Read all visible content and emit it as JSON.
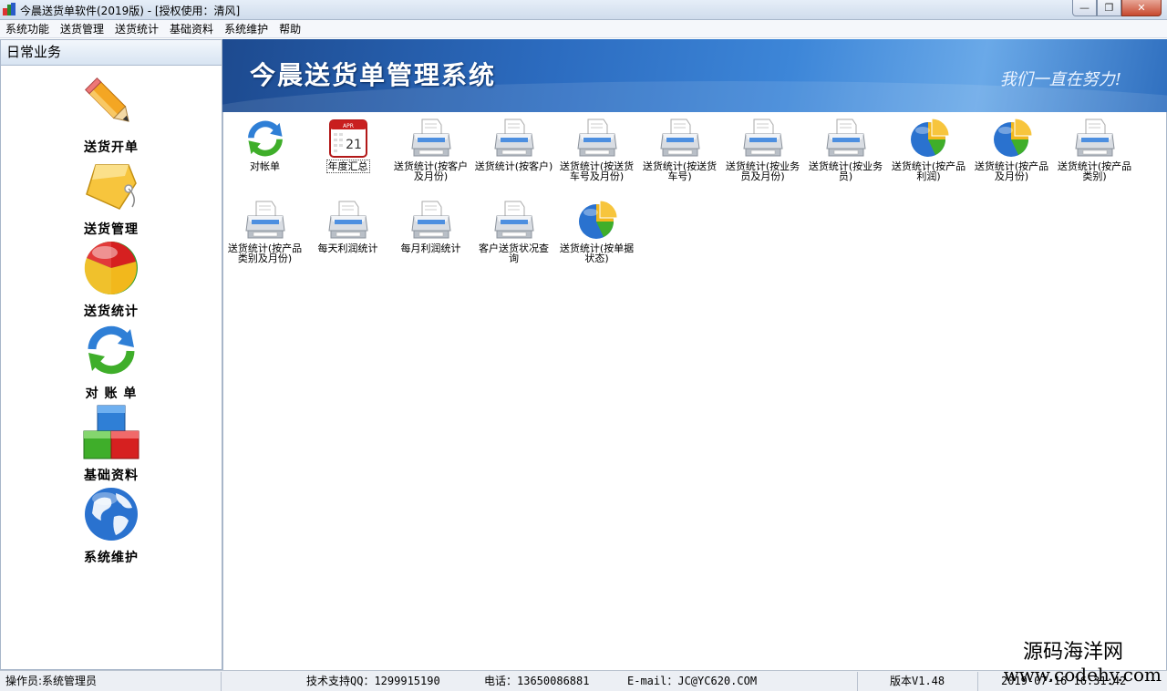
{
  "window": {
    "title": "今晨送货单软件(2019版) - [授权使用：清风]",
    "minimize_glyph": "—",
    "maximize_glyph": "❐",
    "close_glyph": "✕"
  },
  "menu": [
    "系统功能",
    "送货管理",
    "送货统计",
    "基础资料",
    "系统维护",
    "帮助"
  ],
  "left_panel": {
    "header": "日常业务",
    "items": [
      {
        "label": "送货开单",
        "icon": "pencil-icon"
      },
      {
        "label": "送货管理",
        "icon": "tag-icon"
      },
      {
        "label": "送货统计",
        "icon": "pie-ball-icon"
      },
      {
        "label": "对 账 单",
        "icon": "refresh-icon"
      },
      {
        "label": "基础资料",
        "icon": "blocks-icon"
      },
      {
        "label": "系统维护",
        "icon": "globe-icon"
      }
    ]
  },
  "banner": {
    "title": "今晨送货单管理系统",
    "slogan": "我们一直在努力!"
  },
  "tiles": [
    {
      "label": "对帐单",
      "icon": "refresh-icon"
    },
    {
      "label": "年度汇总",
      "icon": "calendar-icon",
      "calendar_month": "APR",
      "calendar_day": "21"
    },
    {
      "label": "送货统计(按客户及月份)",
      "icon": "printer-icon"
    },
    {
      "label": "送货统计(按客户)",
      "icon": "printer-icon"
    },
    {
      "label": "送货统计(按送货车号及月份)",
      "icon": "printer-icon"
    },
    {
      "label": "送货统计(按送货车号)",
      "icon": "printer-icon"
    },
    {
      "label": "送货统计(按业务员及月份)",
      "icon": "printer-icon"
    },
    {
      "label": "送货统计(按业务员)",
      "icon": "printer-icon"
    },
    {
      "label": "送货统计(按产品利润)",
      "icon": "pie-chart-icon"
    },
    {
      "label": "送货统计(按产品及月份)",
      "icon": "pie-chart-icon"
    },
    {
      "label": "送货统计(按产品类别)",
      "icon": "printer-icon"
    },
    {
      "label": "送货统计(按产品类别及月份)",
      "icon": "printer-icon"
    },
    {
      "label": "每天利润统计",
      "icon": "printer-icon"
    },
    {
      "label": "每月利润统计",
      "icon": "printer-icon"
    },
    {
      "label": "客户送货状况查询",
      "icon": "printer-icon"
    },
    {
      "label": "送货统计(按单据状态)",
      "icon": "pie-chart-icon"
    }
  ],
  "status": {
    "operator": "操作员:系统管理员",
    "support_qq": "技术支持QQ：1299915190",
    "phone": "电话：13650086881",
    "email": "E-mail：JC@YC620.COM",
    "version": "版本V1.48",
    "datetime": "2019-07-16 16:31:42"
  },
  "watermark": {
    "name": "源码海洋网",
    "url": "www.codehy.com"
  },
  "colors": {
    "banner_dark": "#1d4a8f",
    "banner_light": "#6aa9e8",
    "panel_border": "#a8b6c9"
  }
}
